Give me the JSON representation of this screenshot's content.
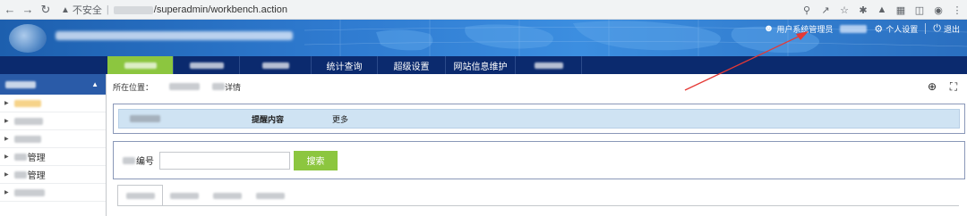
{
  "browser": {
    "insecure_label": "不安全",
    "url_path": "/superadmin/workbench.action"
  },
  "header": {
    "user_label": "用户系统管理员",
    "settings_label": "个人设置",
    "logout_label": "退出",
    "annotation_arrow_color": "#e53935"
  },
  "menu": {
    "items": [
      "",
      "",
      "",
      "统计查询",
      "超级设置",
      "网站信息维护",
      ""
    ],
    "active_color": "#8cc63f"
  },
  "sidebar": {
    "items": [
      "",
      "",
      "",
      "管理",
      "管理",
      ""
    ]
  },
  "breadcrumb": {
    "label": "所在位置：",
    "tail": "详情"
  },
  "notice": {
    "label": "提醒内容",
    "more": "更多"
  },
  "search": {
    "field_label": "编号",
    "button_label": "搜索",
    "value": ""
  },
  "colors": {
    "banner": "#2f7bd0",
    "menu_bg": "#0b2a6e",
    "sidebar_head": "#2a5ba8",
    "notice_bg": "#cfe3f3",
    "accent_green": "#8cc63f"
  }
}
